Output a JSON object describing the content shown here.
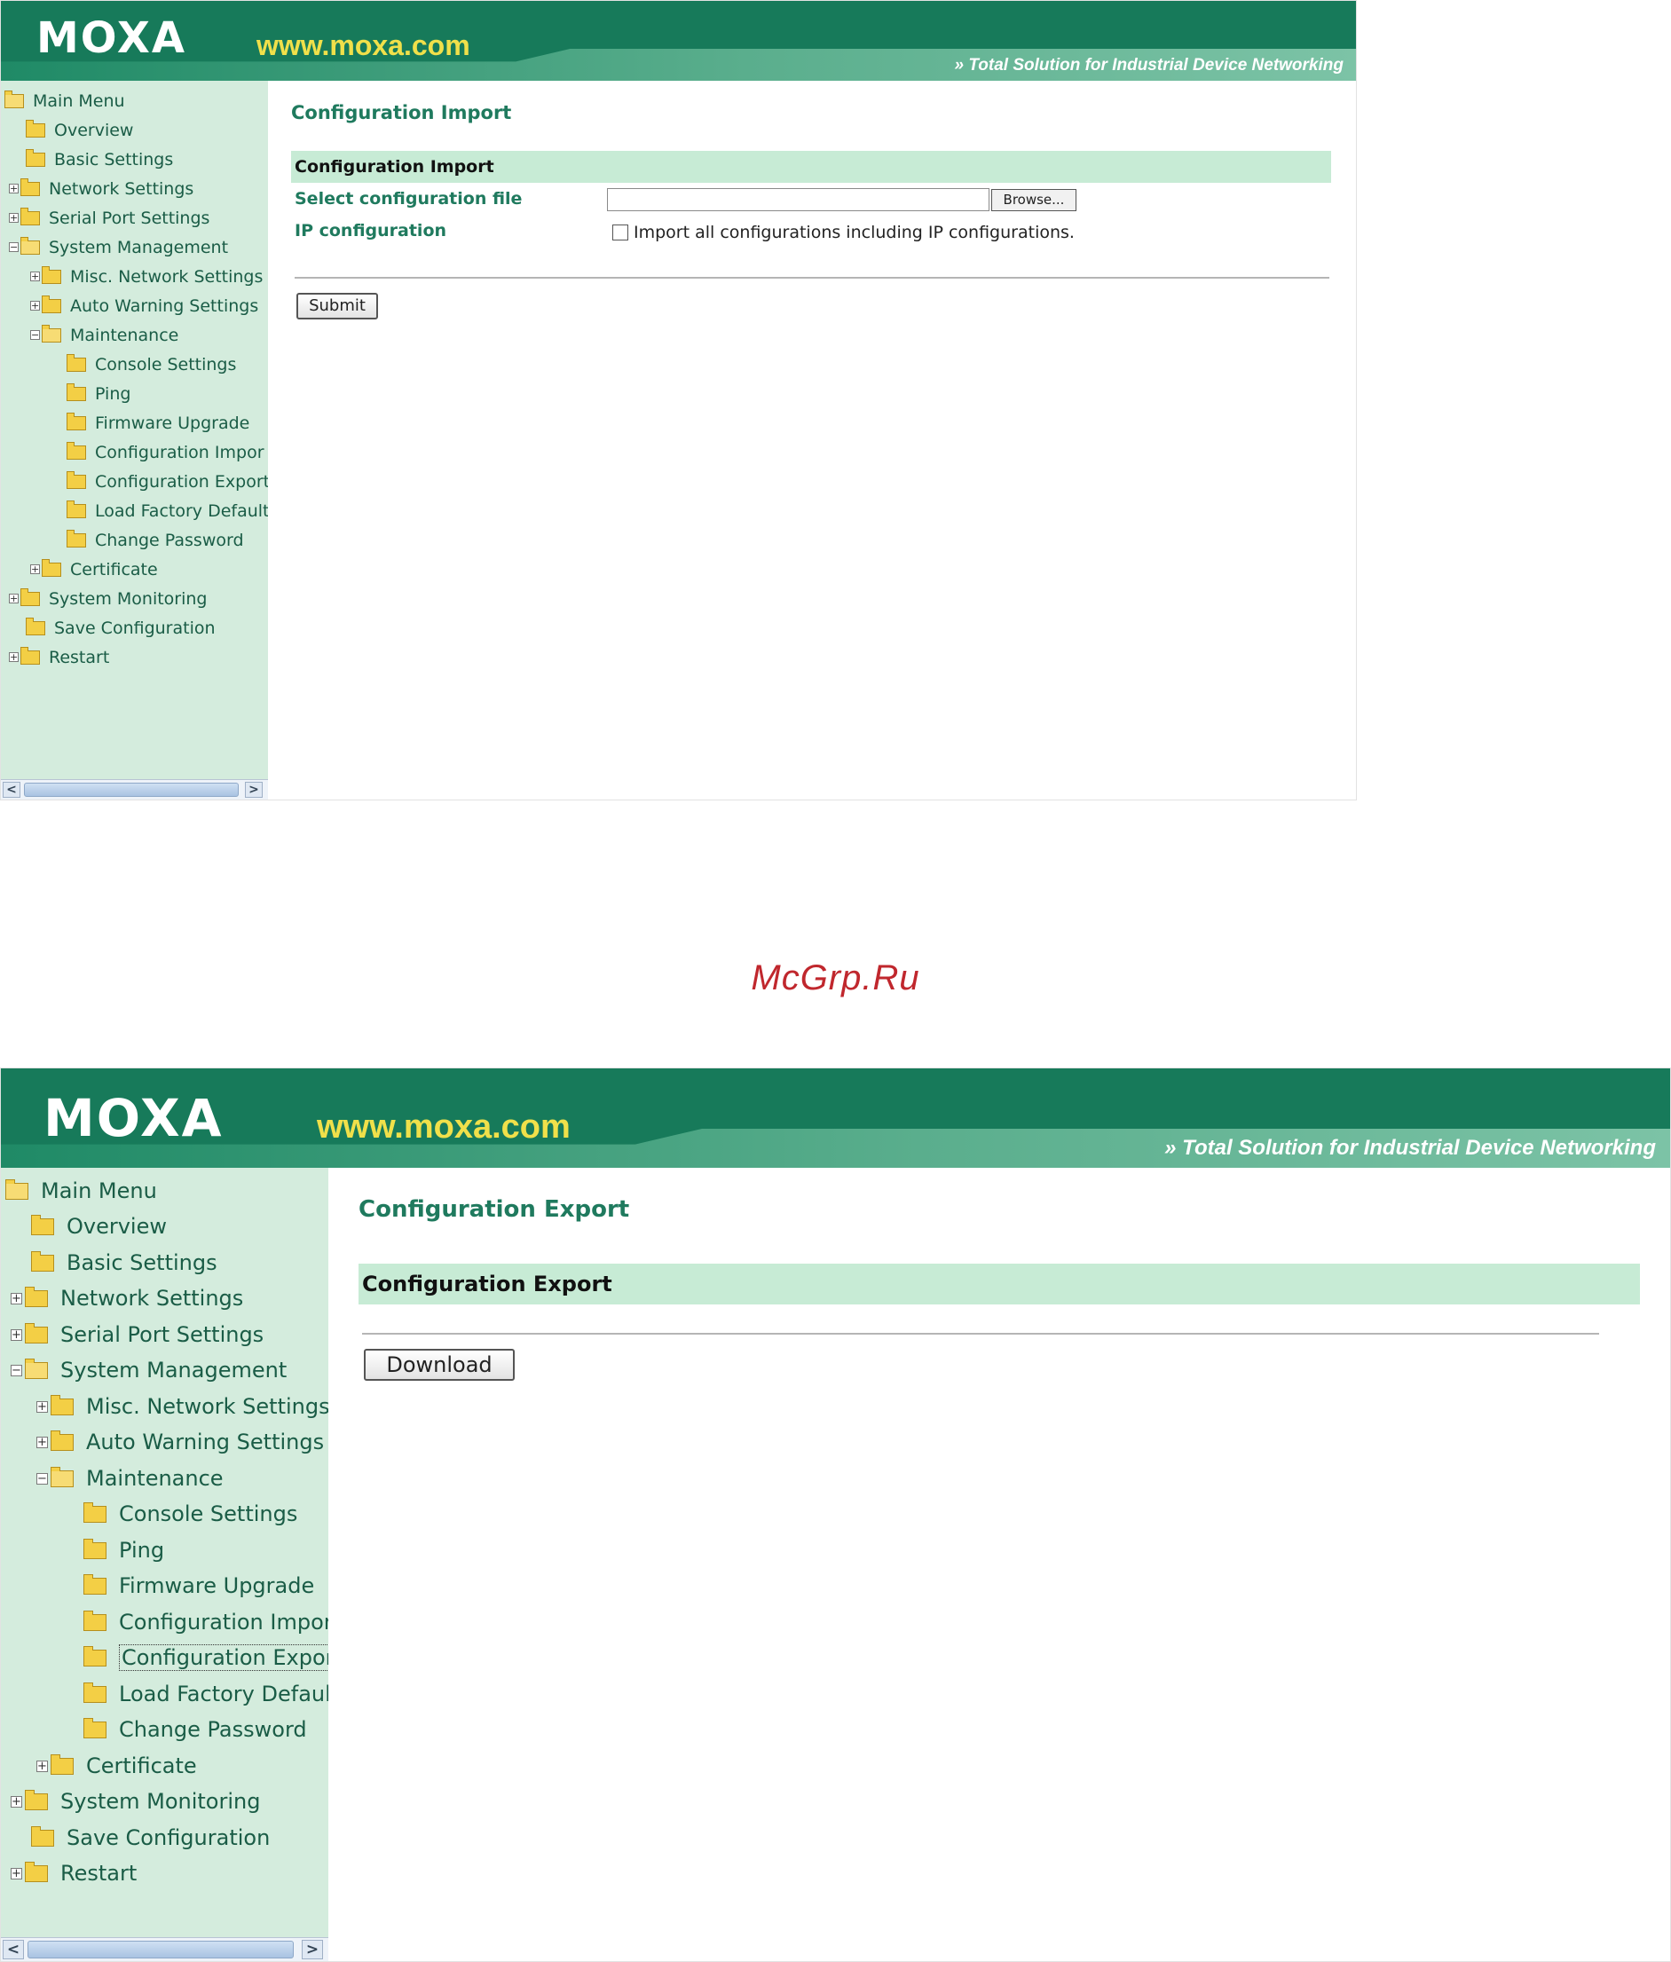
{
  "brand": {
    "logo": "MOXA",
    "url": "www.moxa.com",
    "tagline": "Total Solution for Industrial Device Networking",
    "colors": {
      "header": "#177a5a",
      "sidebar": "#d4ecdd",
      "section_bar": "#c7ebd5",
      "title": "#1f7a5e",
      "url": "#f0e04a",
      "watermark": "#c0272d"
    }
  },
  "tree": {
    "main_menu": "Main Menu",
    "overview": "Overview",
    "basic_settings": "Basic Settings",
    "network_settings": "Network Settings",
    "serial_port_settings": "Serial Port Settings",
    "system_management": "System Management",
    "misc_network_settings": "Misc. Network Settings",
    "auto_warning_settings": "Auto Warning Settings",
    "maintenance": "Maintenance",
    "console_settings": "Console Settings",
    "ping": "Ping",
    "firmware_upgrade": "Firmware Upgrade",
    "configuration_import": "Configuration Impor",
    "configuration_export": "Configuration Export",
    "load_factory_default": "Load Factory Default",
    "change_password": "Change Password",
    "certificate": "Certificate",
    "system_monitoring": "System Monitoring",
    "save_configuration": "Save Configuration",
    "restart": "Restart",
    "expand_symbol": "+",
    "collapse_symbol": "−",
    "scroll_left": "<",
    "scroll_right": ">"
  },
  "import_page": {
    "title": "Configuration Import",
    "section": "Configuration Import",
    "file_label": "Select configuration file",
    "file_value": "",
    "browse_label": "Browse...",
    "ip_label": "IP configuration",
    "ip_checkbox_checked": false,
    "ip_checkbox_text": "Import all configurations including IP configurations.",
    "submit_label": "Submit"
  },
  "export_page": {
    "title": "Configuration Export",
    "section": "Configuration Export",
    "download_label": "Download"
  },
  "watermark": "McGrp.Ru"
}
